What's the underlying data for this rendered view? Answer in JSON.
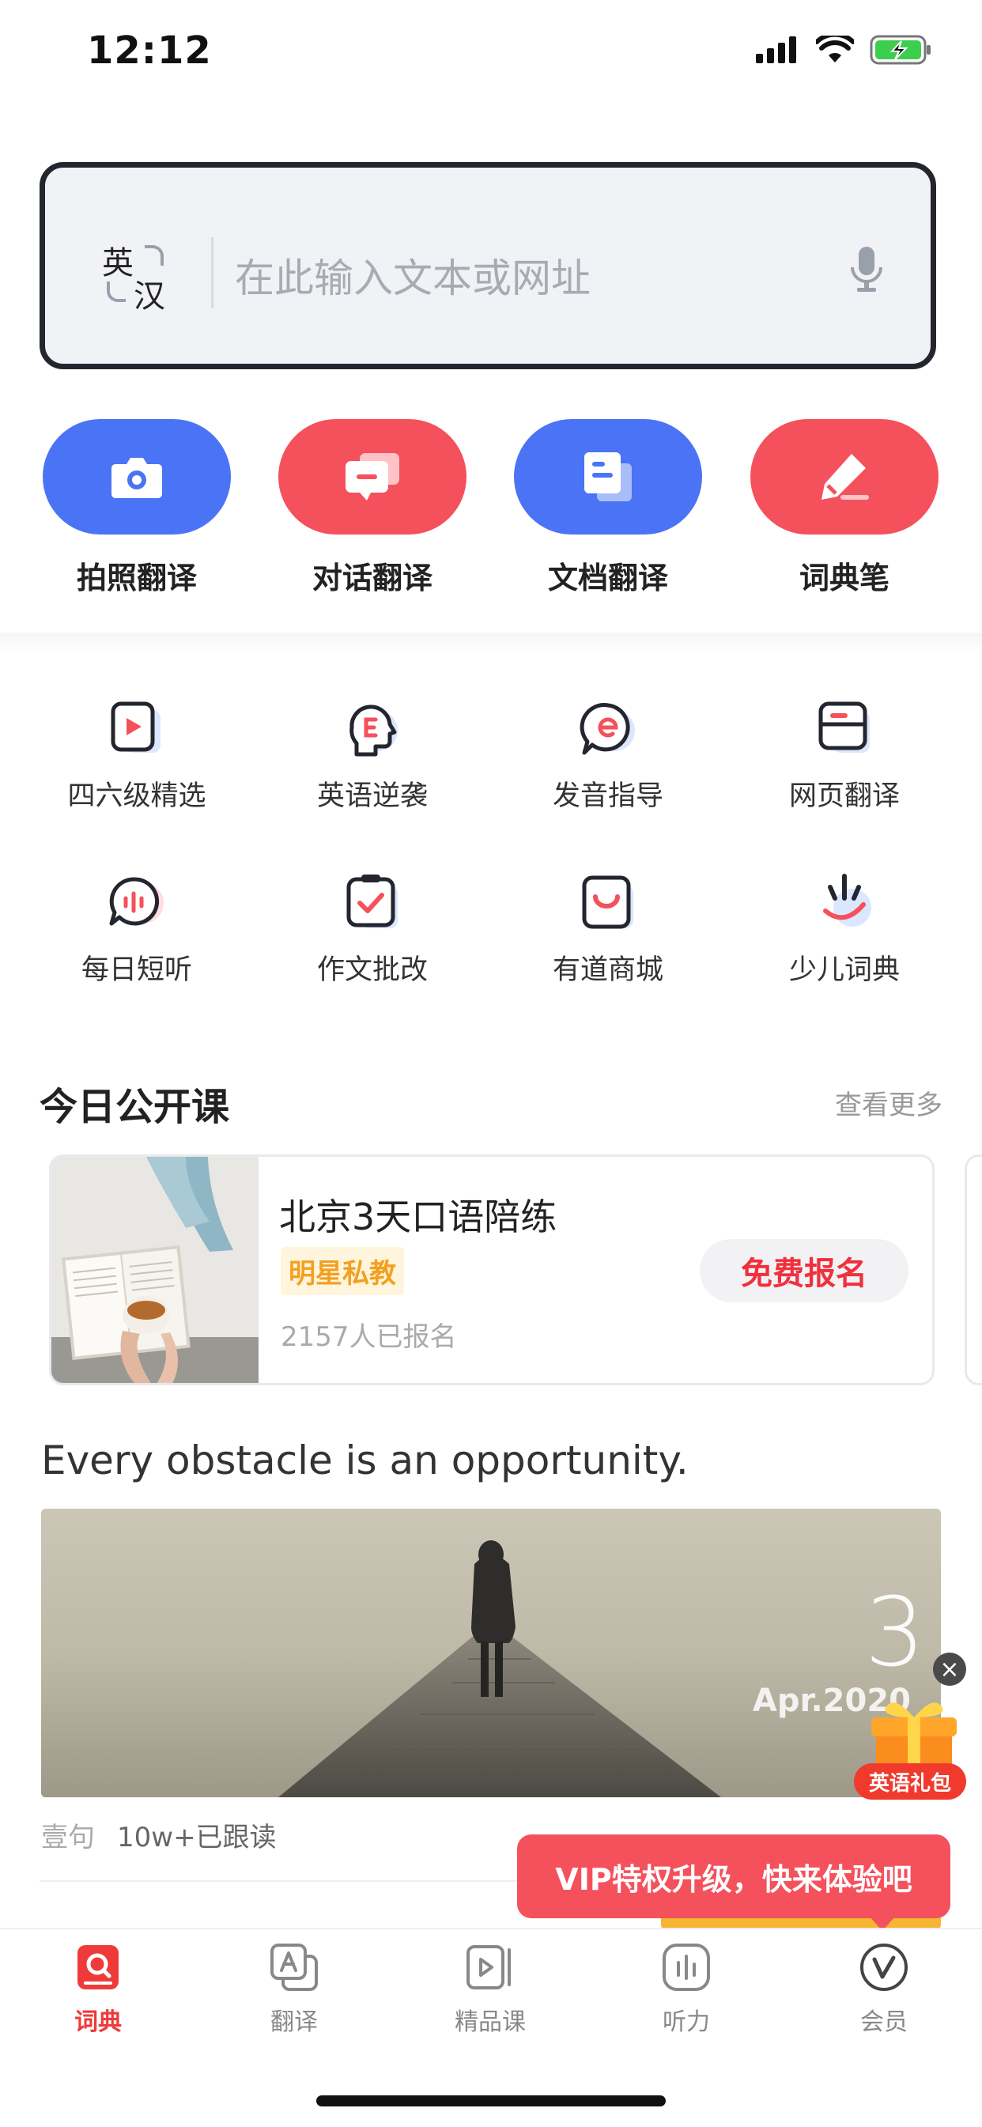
{
  "status_bar": {
    "time": "12:12"
  },
  "search": {
    "lang_from": "英",
    "lang_to": "汉",
    "placeholder": "在此输入文本或网址"
  },
  "quick_actions": [
    {
      "label": "拍照翻译",
      "color": "#4a74f5",
      "icon": "camera-icon"
    },
    {
      "label": "对话翻译",
      "color": "#f4515c",
      "icon": "chat-icon"
    },
    {
      "label": "文档翻译",
      "color": "#4a74f5",
      "icon": "document-icon"
    },
    {
      "label": "词典笔",
      "color": "#f4515c",
      "icon": "pen-icon"
    }
  ],
  "grid": [
    {
      "label": "四六级精选",
      "icon": "video-play-icon"
    },
    {
      "label": "英语逆袭",
      "icon": "head-e-icon"
    },
    {
      "label": "发音指导",
      "icon": "pronunciation-icon"
    },
    {
      "label": "网页翻译",
      "icon": "webpage-icon"
    },
    {
      "label": "每日短听",
      "icon": "listen-bubble-icon"
    },
    {
      "label": "作文批改",
      "icon": "check-clipboard-icon"
    },
    {
      "label": "有道商城",
      "icon": "shopping-bag-icon"
    },
    {
      "label": "少儿词典",
      "icon": "kids-dictionary-icon"
    }
  ],
  "today_class": {
    "title": "今日公开课",
    "see_more": "查看更多",
    "card": {
      "title": "北京3天口语陪练",
      "tag": "明星私教",
      "enrolled": "2157人已报名",
      "button": "免费报名"
    }
  },
  "daily_quote": {
    "text": "Every obstacle is an opportunity.",
    "day": "3",
    "month": "Apr.2020",
    "source": "壹句",
    "readers": "10w+已跟读"
  },
  "gift": {
    "label": "英语礼包",
    "close": "×"
  },
  "vip_toast": "VIP特权升级，快来体验吧",
  "tabs": [
    {
      "label": "词典",
      "active": true,
      "icon": "dictionary-tab-icon"
    },
    {
      "label": "翻译",
      "active": false,
      "icon": "translate-tab-icon"
    },
    {
      "label": "精品课",
      "active": false,
      "icon": "course-tab-icon"
    },
    {
      "label": "听力",
      "active": false,
      "icon": "listening-tab-icon"
    },
    {
      "label": "会员",
      "active": false,
      "icon": "vip-tab-icon"
    }
  ],
  "colors": {
    "blue": "#4a74f5",
    "red": "#f4515c",
    "accent_red": "#f03a3a",
    "tag_orange": "#f3a020"
  }
}
